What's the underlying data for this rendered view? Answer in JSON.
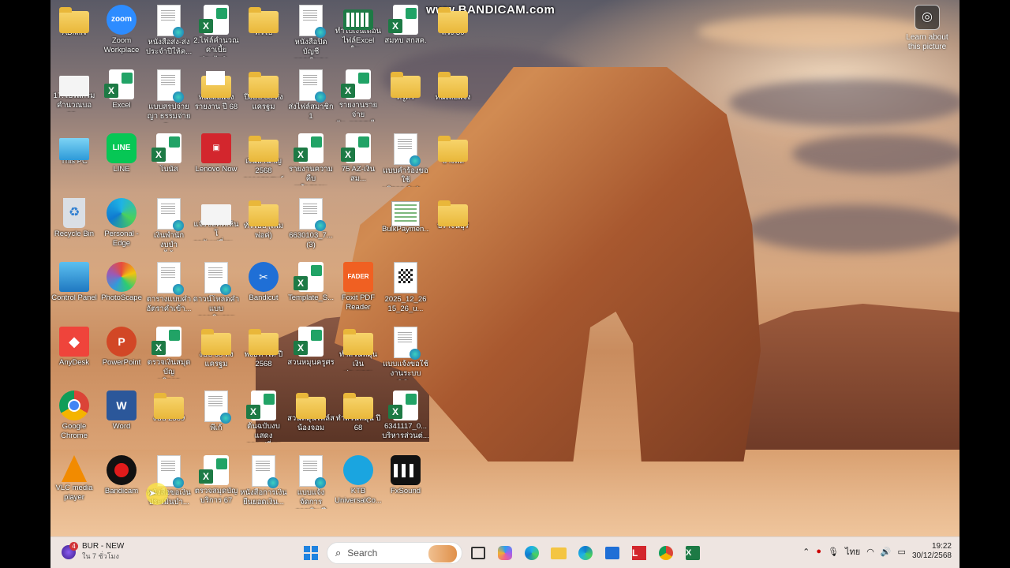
{
  "watermark": "www.BANDICAM.com",
  "learn_more": "Learn about\nthis picture",
  "desktop_icons": [
    {
      "label": "ADMIN",
      "type": "folder"
    },
    {
      "label": "Zoom\nWorkplace",
      "type": "zoom"
    },
    {
      "label": "หนังสือส่ง-ส่ง\nประจำปีให้ค...",
      "type": "doc"
    },
    {
      "label": "2.ไฟล์คำนวณ\nค่าเบี้ยประกัน2...",
      "type": "excel"
    },
    {
      "label": "ทั่วไป",
      "type": "folder"
    },
    {
      "label": "หนังสือปิดบัญชี\nยอดเงินคงเหลือ",
      "type": "doc"
    },
    {
      "label": "ทำใบเงินเดือน\nไฟล์Excel ใน...",
      "type": "green"
    },
    {
      "label": "สมทบ สกสค.",
      "type": "excel"
    },
    {
      "label": "ล่วง 30",
      "type": "folder"
    },
    {
      "label": "17.โปรแกรม\nคำนวณบอกร...",
      "type": "white"
    },
    {
      "label": "Excel",
      "type": "excel"
    },
    {
      "label": "แบบสรุปจ่าย\nญา ธรรมจ่ายต...",
      "type": "doc"
    },
    {
      "label": "หนังสือแจ้ง\nรายงาน ปี 68",
      "type": "folderdoc"
    },
    {
      "label": "ปีงบปี 68 ทั้ง\nแครฐม",
      "type": "folder"
    },
    {
      "label": "ส่งไฟล์สมาชิก 1",
      "type": "doc"
    },
    {
      "label": "รายงานรายจ่าย\nคัน_ยอดสงไ...",
      "type": "excel"
    },
    {
      "label": "ครูศร",
      "type": "folder"
    },
    {
      "label": "หนังสือแจ้ง",
      "type": "folder"
    },
    {
      "label": "This PC",
      "type": "pc"
    },
    {
      "label": "LINE",
      "type": "line"
    },
    {
      "label": "โบนัส",
      "type": "excel"
    },
    {
      "label": "Lenovo Now",
      "type": "lenovo"
    },
    {
      "label": "เงินบำนาญ 2568\nกาารสุดสุนย์",
      "type": "folder"
    },
    {
      "label": "รายงานความคืบ\nหน้าสถานบริ...",
      "type": "excel"
    },
    {
      "label": "75 AZ-เงินสม...",
      "type": "excel"
    },
    {
      "label": "แบบคำร้องขอใช้\nบริการ-Soft-...",
      "type": "doc"
    },
    {
      "label": "ปางพลิ",
      "type": "folder"
    },
    {
      "label": "Recycle Bin",
      "type": "bin"
    },
    {
      "label": "Personal -\nEdge",
      "type": "edge"
    },
    {
      "label": "เงินพำนักงบบำ\nได้",
      "type": "doc"
    },
    {
      "label": "แจ้งข้อคิดเห็นโ\nรกลับเปลี่ยน...",
      "type": "white"
    },
    {
      "label": "ทั่วไปบ (เพิ่ม\nพ่อค่)",
      "type": "folder"
    },
    {
      "label": "6630103_7...\n(3)",
      "type": "doc"
    },
    {
      "label": "",
      "type": "none"
    },
    {
      "label": "BulkPaymen...",
      "type": "bulk"
    },
    {
      "label": "ปราจีนบุรี",
      "type": "folder"
    },
    {
      "label": "Control Panel",
      "type": "cp"
    },
    {
      "label": "PhotoScape",
      "type": "ps"
    },
    {
      "label": "ตารางแบบคำ\nอัตราคำเข้า...",
      "type": "doc"
    },
    {
      "label": "ดาวน์โหลดคำ แบบ\nการเงินรายปี...",
      "type": "doc"
    },
    {
      "label": "Bandicut",
      "type": "bandicut"
    },
    {
      "label": "Template_S...",
      "type": "excel"
    },
    {
      "label": "Foxit PDF\nReader",
      "type": "foxit"
    },
    {
      "label": "2025_12_26\n15_26_u...",
      "type": "qr"
    },
    {
      "label": "",
      "type": "none"
    },
    {
      "label": "AnyDesk",
      "type": "any"
    },
    {
      "label": "PowerPoint",
      "type": "ppt"
    },
    {
      "label": "ตรวจเงินสมุดบัญ\nบริการ",
      "type": "excel"
    },
    {
      "label": "งบปี 68 ทั้ง\nแครฐม",
      "type": "folder"
    },
    {
      "label": "พงษ์ทำให้ ปี\n2568",
      "type": "folder"
    },
    {
      "label": "สวนหมุนครูศร",
      "type": "excel"
    },
    {
      "label": "ทำสวนหมุนเงิน\nประมาณ 2568",
      "type": "folder"
    },
    {
      "label": "แบบแจ้งขอใช้\nงานระบบ GC...",
      "type": "doc"
    },
    {
      "label": "",
      "type": "none"
    },
    {
      "label": "Google\nChrome",
      "type": "chrome"
    },
    {
      "label": "Word",
      "type": "word"
    },
    {
      "label": "งบปี 2569",
      "type": "folder"
    },
    {
      "label": "พี่เก้",
      "type": "doc"
    },
    {
      "label": "ต้นฉบับงบแสดง\nการเปลี่ยนแป...",
      "type": "excel"
    },
    {
      "label": "สวนหมุนไฟล์ส\nน้องจอม",
      "type": "folder"
    },
    {
      "label": "ทำสวนหมุน ปี 68",
      "type": "folder"
    },
    {
      "label": "6341117_0...\nบริหารส่วนต่...",
      "type": "excel"
    },
    {
      "label": "",
      "type": "none"
    },
    {
      "label": "VLC media\nplayer",
      "type": "vlc"
    },
    {
      "label": "Bandicam",
      "type": "band"
    },
    {
      "label": "หนังสือขอเงิน\nประเมินบำ...",
      "type": "doc"
    },
    {
      "label": "ตรวจสมุดบัญ\nบริการ 67",
      "type": "excel"
    },
    {
      "label": "หนังสือการเงิน\nยืนยอดเงิน...",
      "type": "doc"
    },
    {
      "label": "แบบแจ้งจัดการ\nการเงิน ปี 2568",
      "type": "doc"
    },
    {
      "label": "KTB\nUniversalCo...",
      "type": "ktb"
    },
    {
      "label": "FxSound",
      "type": "sound"
    },
    {
      "label": "",
      "type": "none"
    }
  ],
  "taskbar": {
    "news_badge": "4",
    "news_title": "BUR - NEW",
    "news_subtitle": "ใน 7 ชั่วโมง",
    "search_placeholder": "Search",
    "language": "ไทย",
    "time": "19:22",
    "date": "30/12/2568"
  }
}
